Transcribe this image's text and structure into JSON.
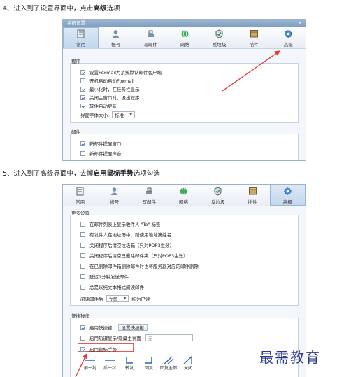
{
  "step4": {
    "prefix": "4、进入到了设置界面中，点击",
    "bold": "高级",
    "suffix": "选项"
  },
  "step5": {
    "prefix": "5、进入到了高级界面中，去掉",
    "bold": "启用鼠标手势",
    "suffix": "选项勾选"
  },
  "window1": {
    "title": "系统设置",
    "close": "✕",
    "tabs": [
      {
        "label": "常用",
        "icon": "general-icon",
        "active": true
      },
      {
        "label": "帐号",
        "icon": "account-icon"
      },
      {
        "label": "写邮件",
        "icon": "compose-icon"
      },
      {
        "label": "网络",
        "icon": "network-icon"
      },
      {
        "label": "反垃圾",
        "icon": "antispam-icon"
      },
      {
        "label": "插件",
        "icon": "plugin-icon"
      },
      {
        "label": "高级",
        "icon": "advanced-icon"
      }
    ],
    "program_group": {
      "title": "程序",
      "items": [
        {
          "label": "设置Foxmail为系统默认邮件客户端",
          "checked": true
        },
        {
          "label": "开机启动启动Foxmail",
          "checked": false
        },
        {
          "label": "最小化时，在任务栏显示",
          "checked": true
        },
        {
          "label": "关闭主窗口时，退出程序",
          "checked": true
        },
        {
          "label": "软件自动更新",
          "checked": true
        }
      ],
      "font_size_label": "界面字体大小:",
      "font_size_value": "标准"
    },
    "mail_group": {
      "title": "邮件",
      "items": [
        {
          "label": "新邮件提醒窗口",
          "checked": true
        },
        {
          "label": "新邮件提醒声音",
          "checked": false
        }
      ]
    }
  },
  "window2": {
    "tabs": [
      {
        "label": "常用",
        "icon": "general-icon"
      },
      {
        "label": "帐号",
        "icon": "account-icon"
      },
      {
        "label": "写邮件",
        "icon": "compose-icon"
      },
      {
        "label": "网络",
        "icon": "network-icon"
      },
      {
        "label": "反垃圾",
        "icon": "antispam-icon"
      },
      {
        "label": "插件",
        "icon": "plugin-icon"
      },
      {
        "label": "高级",
        "icon": "advanced-icon",
        "active": true
      }
    ],
    "more_group": {
      "title": "更多设置",
      "items": [
        {
          "label": "在邮件列表上显示收件人 \"To\" 标签",
          "checked": false
        },
        {
          "label": "有发件人在地址簿中，则使用地址簿姓名",
          "checked": false
        },
        {
          "label": "关闭程序后清空垃圾箱（只对POP3生效）",
          "checked": false
        },
        {
          "label": "关闭程序后清空已删除邮件夹（只对POP3生效）",
          "checked": false
        },
        {
          "label": "在已删除邮件箱删除邮件时也将服务器对应的邮件删除",
          "checked": false
        },
        {
          "label": "延迟1分钟发送邮件",
          "checked": false
        },
        {
          "label": "总是以纯文本格式阅读邮件",
          "checked": false
        }
      ],
      "read_label": "阅读邮件后",
      "read_value": "立即",
      "read_suffix": "标为已读"
    },
    "shortcut_group": {
      "title": "快捷操作",
      "hotkey_label": "启用快捷键",
      "hotkey_checked": true,
      "hotkey_button": "设置快捷键",
      "hide_label": "启用热键显示/隐藏主界面",
      "hide_checked": false,
      "hide_value": "无",
      "gesture_label": "启用鼠标手势",
      "gesture_checked": true,
      "gestures": [
        "前一封",
        "后一封",
        "转发",
        "回复",
        "回复全部",
        "关闭"
      ]
    }
  },
  "watermark": "最需教育",
  "colors": {
    "accent": "#2a63b8",
    "arrow": "#e53935",
    "watermark": "#2d3a8c"
  }
}
